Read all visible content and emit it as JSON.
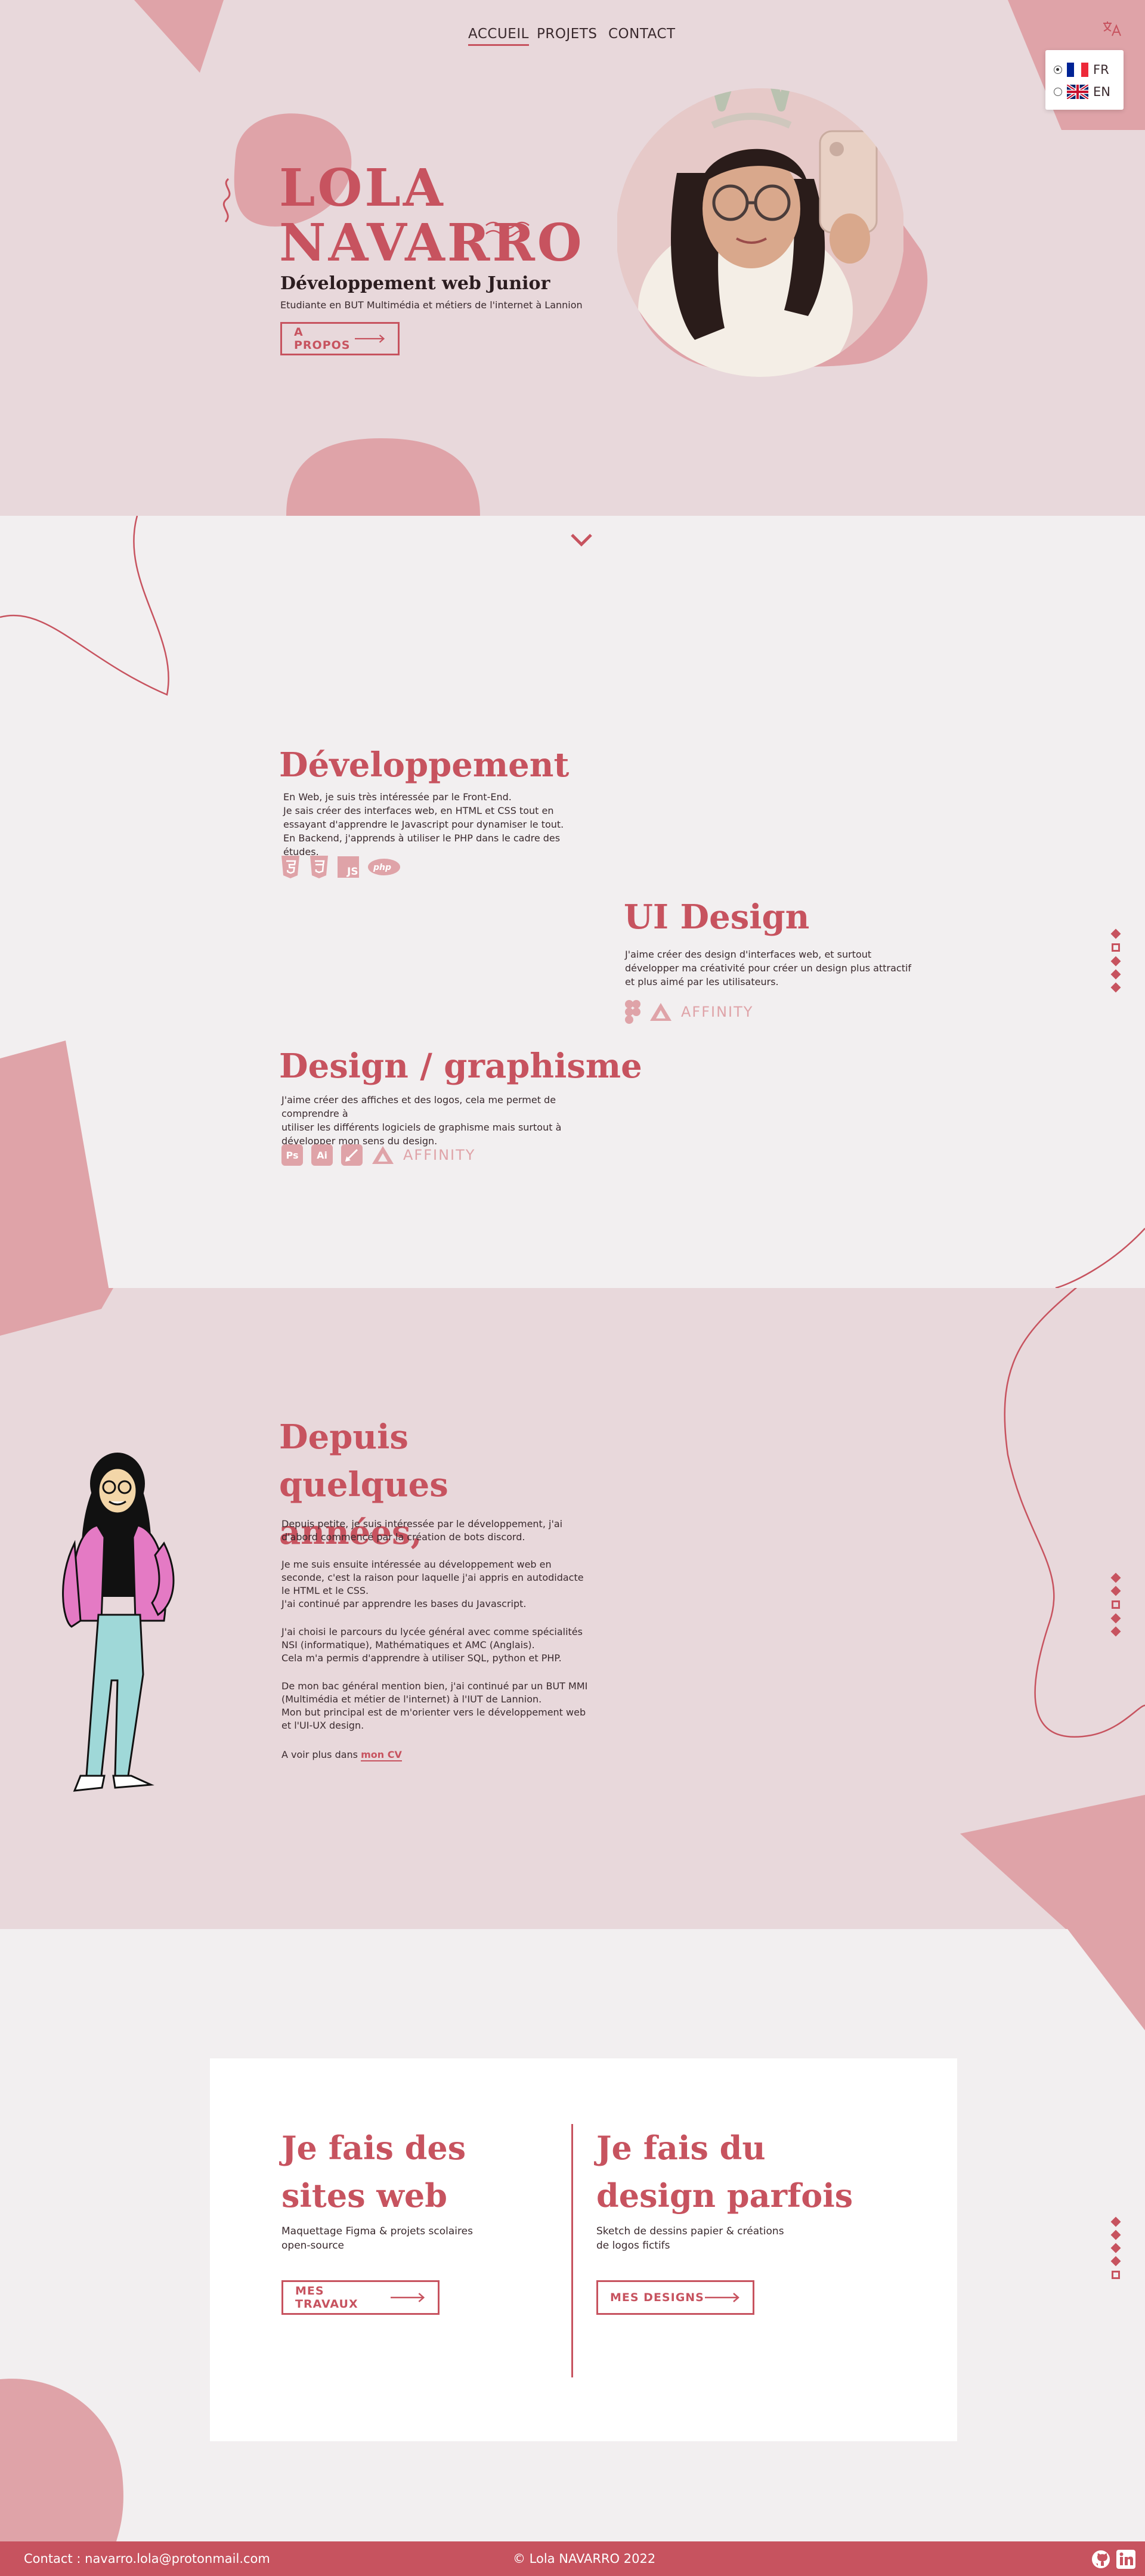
{
  "nav": {
    "items": [
      "ACCUEIL",
      "PROJETS",
      "CONTACT"
    ]
  },
  "language": {
    "options": [
      {
        "code": "FR",
        "selected": true
      },
      {
        "code": "EN",
        "selected": false
      }
    ],
    "icon": "translate-icon"
  },
  "hero": {
    "name_line1": "LOLA",
    "name_line2": "NAVARRO",
    "subtitle": "Développement web Junior",
    "tagline": "Etudiante en BUT Multimédia et métiers de l'internet à Lannion",
    "button_label": "A PROPOS"
  },
  "skills": {
    "dev": {
      "title": "Développement",
      "lines": [
        "En Web, je suis très intéressée par le Front-End.",
        "Je sais créer des interfaces web, en HTML et CSS tout en",
        "essayant d'apprendre le Javascript pour dynamiser le tout.",
        "En Backend, j'apprends à utiliser le PHP dans le cadre des études."
      ],
      "icons": [
        "html5-icon",
        "css3-icon",
        "js-icon",
        "php-icon"
      ]
    },
    "ui": {
      "title": "UI Design",
      "lines": [
        "J'aime créer des design d'interfaces web, et surtout",
        "développer ma créativité pour créer un design plus attractif",
        "et plus aimé par les utilisateurs."
      ],
      "icons": [
        "figma-icon",
        "affinity-icon"
      ],
      "affinity_label": "AFFINITY"
    },
    "design": {
      "title": "Design / graphisme",
      "lines": [
        "J'aime créer des affiches et des logos, cela me permet de comprendre à",
        "utiliser les différents logiciels de graphisme mais surtout à",
        "développer mon sens du design."
      ],
      "icons": [
        "photoshop-icon",
        "illustrator-icon",
        "procreate-icon",
        "affinity-icon"
      ],
      "ps_label": "Ps",
      "ai_label": "Ai",
      "affinity_label": "AFFINITY"
    }
  },
  "about": {
    "title": "Depuis quelques années,",
    "p1": "Depuis petite, je suis intéressée par le développement, j'ai d'abord commencé par la création de bots discord.",
    "p2a": "Je me suis ensuite intéressée au développement web en seconde, c'est la raison pour laquelle j'ai appris en autodidacte le HTML et le CSS.",
    "p2b": "J'ai continué par apprendre les bases du Javascript.",
    "p3a": "J'ai choisi le parcours du lycée général avec comme spécialités NSI (informatique), Mathématiques et AMC (Anglais).",
    "p3b": "Cela m'a permis d'apprendre à utiliser SQL, python et PHP.",
    "p4a": "De mon bac général mention bien, j'ai continué par un BUT MMI (Multimédia et métier de l'internet) à l'IUT de Lannion.",
    "p4b": "Mon but principal est de m'orienter vers le développement web et l'UI-UX design.",
    "more_prefix": "A voir plus dans",
    "cv_link": "mon CV"
  },
  "offers": {
    "web": {
      "title": "Je fais des sites web",
      "text_line1": "Maquettage Figma & projets scolaires",
      "text_line2": "open-source",
      "button": "MES TRAVAUX"
    },
    "design": {
      "title": "Je fais du design parfois",
      "text_line1": "Sketch de dessins papier & créations",
      "text_line2": "de logos fictifs",
      "button": "MES DESIGNS"
    }
  },
  "footer": {
    "contact": "Contact : navarro.lola@protonmail.com",
    "copyright": "© Lola NAVARRO 2022",
    "icons": [
      "github-icon",
      "linkedin-icon"
    ]
  },
  "colors": {
    "accent": "#c7535f",
    "pink_light": "#e8d8db",
    "pink_shape": "#dfa3a8",
    "background": "#f2eff0"
  }
}
